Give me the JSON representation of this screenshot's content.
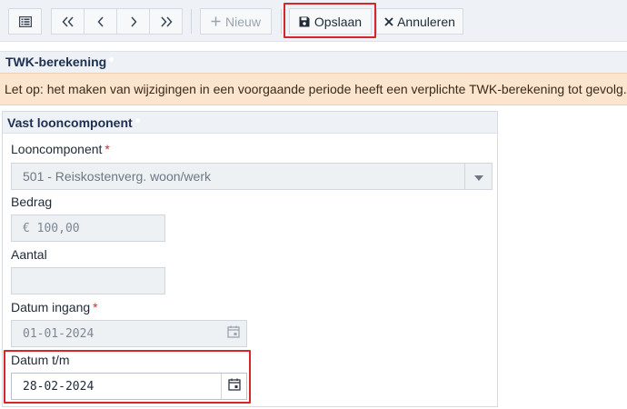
{
  "toolbar": {
    "new_label": "Nieuw",
    "save_label": "Opslaan",
    "cancel_label": "Annuleren",
    "icons": [
      "list-icon",
      "first-page-icon",
      "previous-icon",
      "next-icon",
      "last-page-icon",
      "plus-icon",
      "save-icon",
      "close-icon"
    ]
  },
  "twk_section": {
    "title": "TWK-berekening",
    "warning": "Let op: het maken van wijzigingen in een voorgaande periode heeft een verplichte TWK-berekening tot gevolg."
  },
  "vast_section": {
    "title": "Vast looncomponent",
    "fields": {
      "looncomponent": {
        "label": "Looncomponent",
        "required_marker": "*",
        "value": "501 - Reiskostenverg. woon/werk"
      },
      "bedrag": {
        "label": "Bedrag",
        "value": "€ 100,00"
      },
      "aantal": {
        "label": "Aantal",
        "value": ""
      },
      "datum_ingang": {
        "label": "Datum ingang",
        "required_marker": "*",
        "value": "01-01-2024"
      },
      "datum_tm": {
        "label": "Datum t/m",
        "value": "28-02-2024"
      }
    }
  },
  "colors": {
    "accent_highlight": "#d6262b",
    "warning_bg": "#fbe5cf",
    "header_bg": "#eef1f5",
    "title_text": "#1e3050"
  }
}
